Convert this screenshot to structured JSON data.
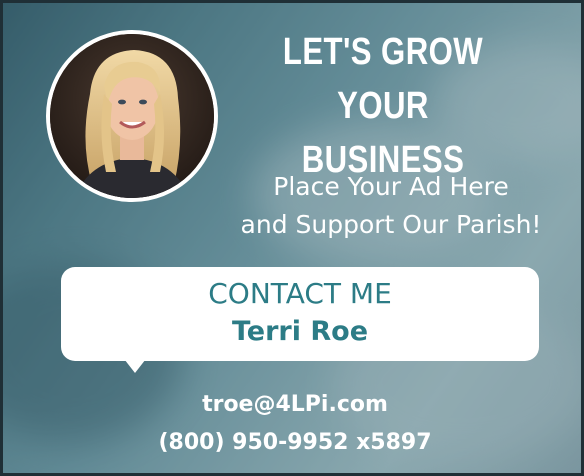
{
  "ad": {
    "headline_line1": "LET'S GROW",
    "headline_line2": "YOUR BUSINESS",
    "tagline_line1": "Place Your Ad Here",
    "tagline_line2": "and Support Our Parish!",
    "contact_heading": "CONTACT ME",
    "contact_name": "Terri Roe",
    "email": "troe@4LPi.com",
    "phone": "(800) 950-9952 x5897"
  },
  "colors": {
    "accent_teal": "#2c7c86",
    "background": "#5f8b96",
    "text_white": "#ffffff"
  }
}
